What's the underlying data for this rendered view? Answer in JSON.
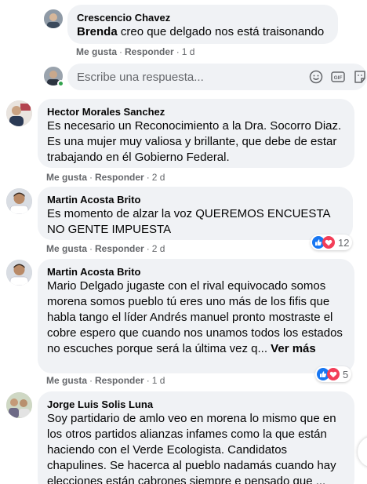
{
  "reply_thread": {
    "author": "Crescencio Chavez",
    "mention": "Brenda",
    "text": " creo que delgado nos está traisonando",
    "actions": {
      "like": "Me gusta",
      "reply": "Responder",
      "time": "1 d"
    }
  },
  "reply_composer": {
    "placeholder": "Escribe una respuesta...",
    "icons": [
      "emoji-icon",
      "gif-icon",
      "sticker-icon"
    ]
  },
  "comments": [
    {
      "author": "Hector Morales Sanchez",
      "text": "Es necesario un Reconocimiento a la Dra. Socorro Diaz. Es una mujer muy valiosa y brillante, que debe de estar trabajando en él Gobierno Federal.",
      "actions": {
        "like": "Me gusta",
        "reply": "Responder",
        "time": "2 d"
      }
    },
    {
      "author": "Martin Acosta Brito",
      "text": "Es momento de alzar la voz QUEREMOS ENCUESTA NO GENTE IMPUESTA",
      "actions": {
        "like": "Me gusta",
        "reply": "Responder",
        "time": "2 d"
      },
      "reactions": {
        "count": "12",
        "types": [
          "like",
          "love"
        ]
      }
    },
    {
      "author": "Martin Acosta Brito",
      "text": "Mario Delgado jugaste con el rival equivocado somos morena somos pueblo tú eres uno más de los fifis que habla tango el líder Andrés manuel pronto mostraste el cobre espero que cuando nos unamos todos los estados no escuches porque será la última vez q...",
      "see_more": "Ver más",
      "actions": {
        "like": "Me gusta",
        "reply": "Responder",
        "time": "1 d"
      },
      "reactions": {
        "count": "5",
        "types": [
          "like",
          "love"
        ]
      }
    },
    {
      "author": "Jorge Luis Solis Luna",
      "text": "Soy partidario de amlo veo en morena lo mismo que en los otros partidos alianzas infames como la que están haciendo con el Verde Ecologista. Candidatos chapulines. Se hacerca al pueblo nadamás cuando hay elecciones están cabrones siempre e pensado que ..."
    }
  ],
  "colors": {
    "bubble": "#f0f2f5",
    "secondary_text": "#65676b",
    "like_blue": "#1877f2",
    "love_red": "#f33e58",
    "online_green": "#31a24c"
  }
}
